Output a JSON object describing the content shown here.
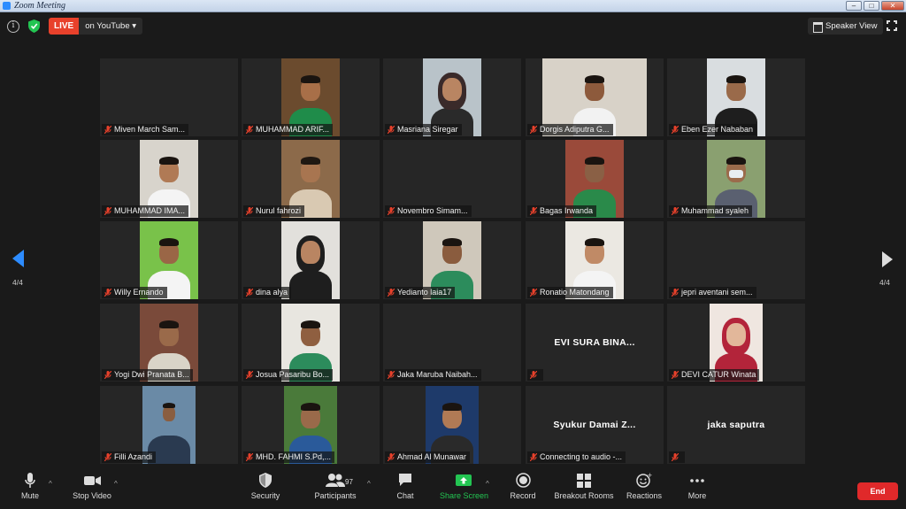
{
  "window": {
    "title": "Zoom Meeting"
  },
  "topbar": {
    "live_tag": "LIVE",
    "live_dest": "on YouTube",
    "speaker_view": "Speaker View"
  },
  "pagination": {
    "left": "4/4",
    "right": "4/4"
  },
  "participants": [
    {
      "name": "Miven March Sam..."
    },
    {
      "name": "MUHAMMAD ARIF..."
    },
    {
      "name": "Masriana Siregar"
    },
    {
      "name": "Dorgis Adiputra G..."
    },
    {
      "name": "Eben Ezer Nababan"
    },
    {
      "name": "MUHAMMAD IMA..."
    },
    {
      "name": "Nurul fahrozi"
    },
    {
      "name": "Novembro Simam..."
    },
    {
      "name": "Bagas Irwanda"
    },
    {
      "name": "Muhammad syaleh"
    },
    {
      "name": "Willy Ernando"
    },
    {
      "name": "dina alya"
    },
    {
      "name": "Yedianto laia17"
    },
    {
      "name": "Ronatio Matondang"
    },
    {
      "name": "jepri aventani sem..."
    },
    {
      "name": "Yogi Dwi Pranata B..."
    },
    {
      "name": "Josua Pasaribu Bo..."
    },
    {
      "name": "Jaka Maruba Naibah..."
    },
    {
      "name": "",
      "display": "EVI SURA BINA..."
    },
    {
      "name": "DEVI CATUR Winata"
    },
    {
      "name": "Filli Azandi"
    },
    {
      "name": "MHD. FAHMI S.Pd,..."
    },
    {
      "name": "Ahmad Al Munawar"
    },
    {
      "name": "Connecting to audio -...",
      "display": "Syukur Damai Z..."
    },
    {
      "name": "",
      "display": "jaka saputra"
    }
  ],
  "toolbar": {
    "mute": "Mute",
    "stop_video": "Stop Video",
    "security": "Security",
    "participants": "Participants",
    "participants_count": "97",
    "chat": "Chat",
    "share_screen": "Share Screen",
    "record": "Record",
    "breakout_rooms": "Breakout Rooms",
    "reactions": "Reactions",
    "more": "More",
    "end": "End"
  },
  "colors": {
    "live": "#e8412b",
    "share": "#23c552",
    "end": "#e0292a",
    "nav_arrow": "#2d8cff"
  }
}
